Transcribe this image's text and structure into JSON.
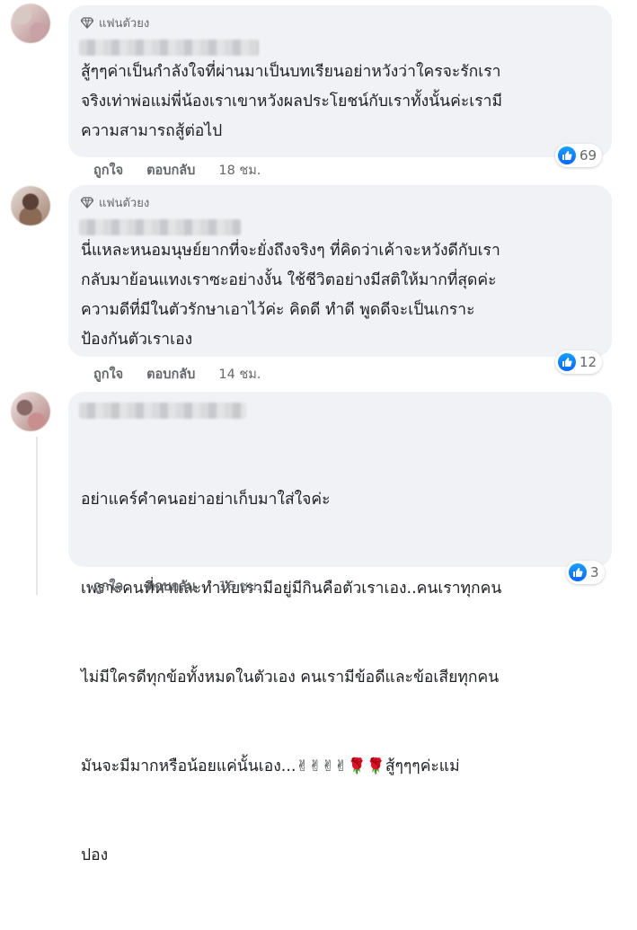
{
  "comments": [
    {
      "badge": "แฟนตัวยง",
      "text": "สู้ๆๆค่าเป็นกำลังใจที่ผ่านมาเป็นบทเรียนอย่าหวังว่าใครจะรักเรา\nจริงเท่าพ่อแม่พี่น้องเราเขาหวังผลประโยชน์กับเราทั้งนั้นค่ะเรามี\nความสามารถสู้ต่อไป",
      "reaction_count": "69",
      "like_label": "ถูกใจ",
      "reply_label": "ตอบกลับ",
      "time": "18 ชม."
    },
    {
      "badge": "แฟนตัวยง",
      "text": "นี่แหละหนอมนุษย์ยากที่จะยั่งถึงจริงๆ ที่คิดว่าเค้าจะหวังดีกับเรา\nกลับมาย้อนแทงเราซะอย่างงั้น ใช้ชีวิตอย่างมีสติให้มากที่สุดค่ะ\nความดีที่มีในตัวรักษาเอาไว้ค่ะ คิดดี ทำดี พูดดีจะเป็นเกราะ\nป้องกันตัวเราเอง",
      "reaction_count": "12",
      "like_label": "ถูกใจ",
      "reply_label": "ตอบกลับ",
      "time": "14 ชม."
    },
    {
      "text_lines": [
        "อย่าแคร์คำคนอย่าอย่าเก็บมาใส่ใจค่ะ",
        "เพราะคนที่หาและทำหัยเรามีอยู่มีกินคือตัวเราเอง..คนเราทุกคน",
        "ไม่มีใครดีทุกข้อทั้งหมดในตัวเอง คนเรามีข้อดีและข้อเสียทุกคน",
        "มันจะมีมากหรือน้อยแค่นั้นเอง...",
        "สู้ๆๆๆค่ะแม่",
        "ปอง"
      ],
      "emojis": [
        "✌",
        "✌",
        "✌",
        "✌",
        "🌹",
        "🌹"
      ],
      "reaction_count": "3",
      "like_label": "ถูกใจ",
      "reply_label": "ตอบกลับ",
      "time": "16 ชม."
    }
  ],
  "colors": {
    "bubble": "#f0f2f5",
    "like_blue": "#0866ff",
    "secondary_text": "#65676b"
  },
  "icons": [
    "diamond-icon",
    "like-icon"
  ]
}
